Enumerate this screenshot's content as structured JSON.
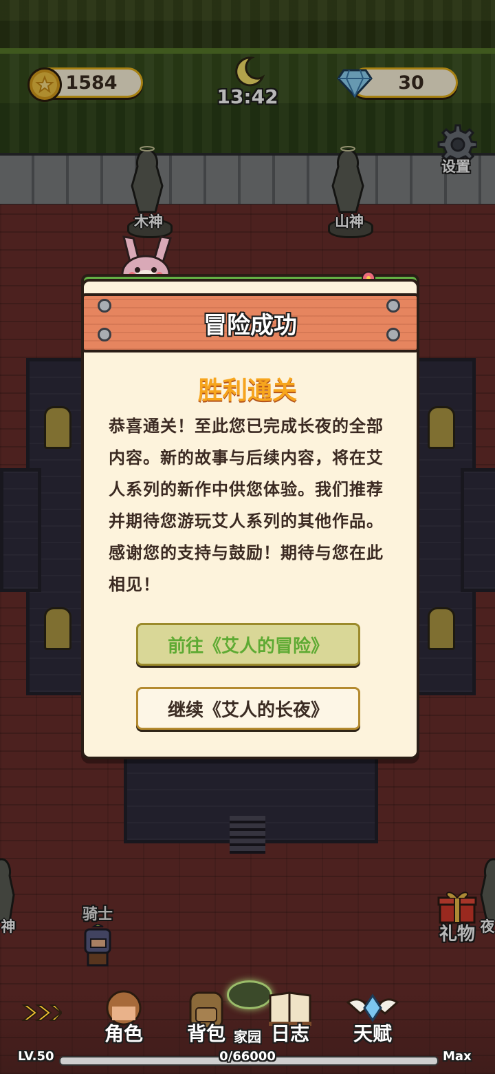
{
  "hud": {
    "coins": "1584",
    "time": "13:42",
    "gems": "30",
    "settings_label": "设置"
  },
  "statues": {
    "wood_god": "木神",
    "mountain_god": "山神",
    "left_partial": "神",
    "right_partial": "夜"
  },
  "character": {
    "name": "骑士"
  },
  "modal": {
    "title": "冒险成功",
    "subtitle": "胜利通关",
    "body": "恭喜通关！至此您已完成长夜的全部内容。新的故事与后续内容，将在艾人系列的新作中供您体验。我们推荐并期待您游玩艾人系列的其他作品。感谢您的支持与鼓励！期待与您在此相见！",
    "primary_button": "前往《艾人的冒险》",
    "secondary_button": "继续《艾人的长夜》"
  },
  "gift": {
    "label": "礼物"
  },
  "bottom_nav": {
    "expand_icon": "chevrons-right-icon",
    "items": [
      {
        "label": "角色",
        "icon": "character-icon"
      },
      {
        "label": "背包",
        "icon": "backpack-icon"
      },
      {
        "label": "家园",
        "icon": "portal-icon"
      },
      {
        "label": "日志",
        "icon": "book-icon"
      },
      {
        "label": "天赋",
        "icon": "winged-gem-icon"
      }
    ]
  },
  "level": {
    "label": "LV.50",
    "xp": "0/66000",
    "max": "Max"
  }
}
